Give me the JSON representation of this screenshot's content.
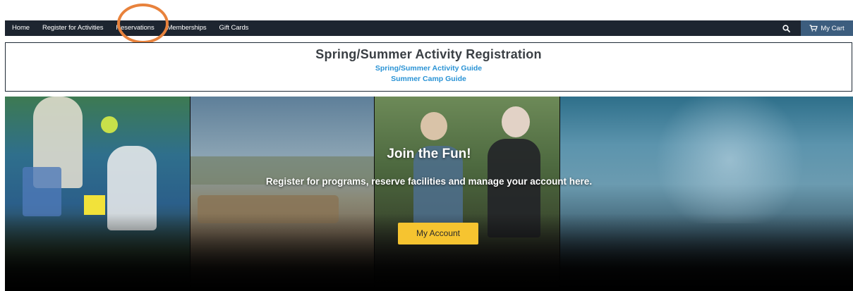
{
  "nav": {
    "items": [
      "Home",
      "Register for Activities",
      "Reservations",
      "Memberships",
      "Gift Cards"
    ],
    "search_icon": "search-icon",
    "cart_label": "My Cart",
    "cart_icon": "cart-icon"
  },
  "banner": {
    "title": "Spring/Summer Activity Registration",
    "links": [
      "Spring/Summer Activity Guide",
      "Summer Camp Guide"
    ]
  },
  "hero": {
    "title": "Join the Fun!",
    "subtitle": "Register for programs, reserve facilities and manage your account here.",
    "button_label": "My Account"
  },
  "colors": {
    "nav_bg": "#1d2530",
    "cart_bg": "#3c5d7e",
    "link": "#2a93d5",
    "button": "#f6c430",
    "annotation": "#e8823c"
  }
}
